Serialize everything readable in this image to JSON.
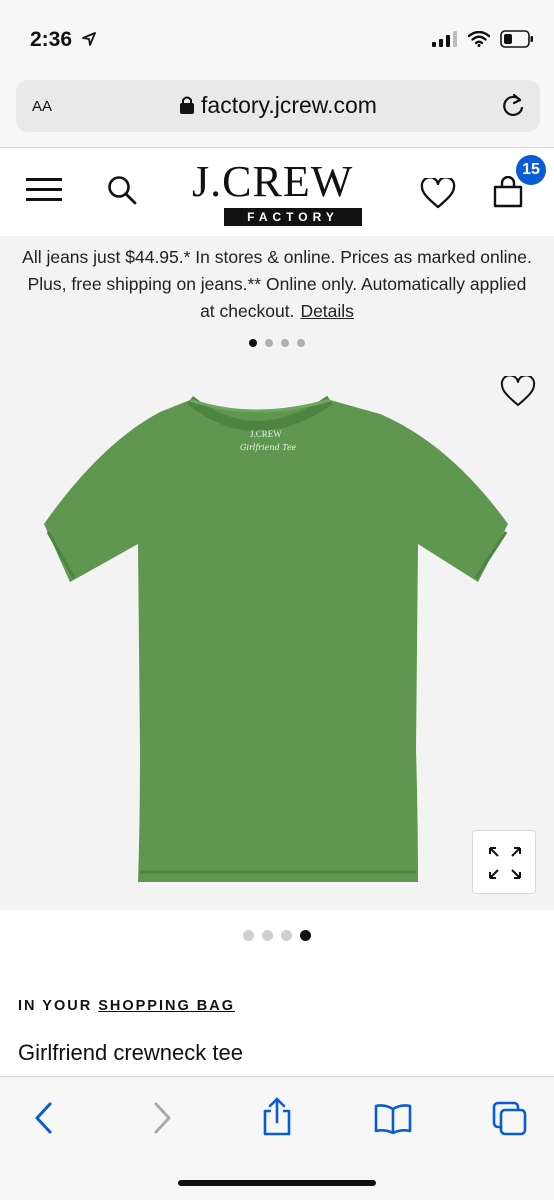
{
  "status_bar": {
    "time": "2:36"
  },
  "browser": {
    "text_size_label": "AA",
    "url": "factory.jcrew.com"
  },
  "header": {
    "logo_text": "J.CREW",
    "logo_subtitle": "FACTORY",
    "bag_count": "15"
  },
  "promo": {
    "text": "All jeans just $44.95.* In stores & online. Prices as marked online. Plus, free shipping on jeans.** Online only. Automatically applied at checkout.",
    "link": "Details"
  },
  "product": {
    "bag_prefix": "IN YOUR ",
    "bag_link": "SHOPPING BAG",
    "title": "Girlfriend crewneck tee",
    "tee_label": "J.CREW",
    "tee_script": "Girlfriend Tee"
  },
  "colors": {
    "accent_blue": "#0a5bd6",
    "tee_green": "#5f9650"
  },
  "icons": [
    "location-arrow-icon",
    "signal-icon",
    "wifi-icon",
    "battery-icon",
    "lock-icon",
    "reload-icon",
    "menu-icon",
    "search-icon",
    "heart-icon",
    "bag-icon",
    "expand-icon",
    "back-icon",
    "forward-icon",
    "share-icon",
    "bookmarks-icon",
    "tabs-icon"
  ]
}
